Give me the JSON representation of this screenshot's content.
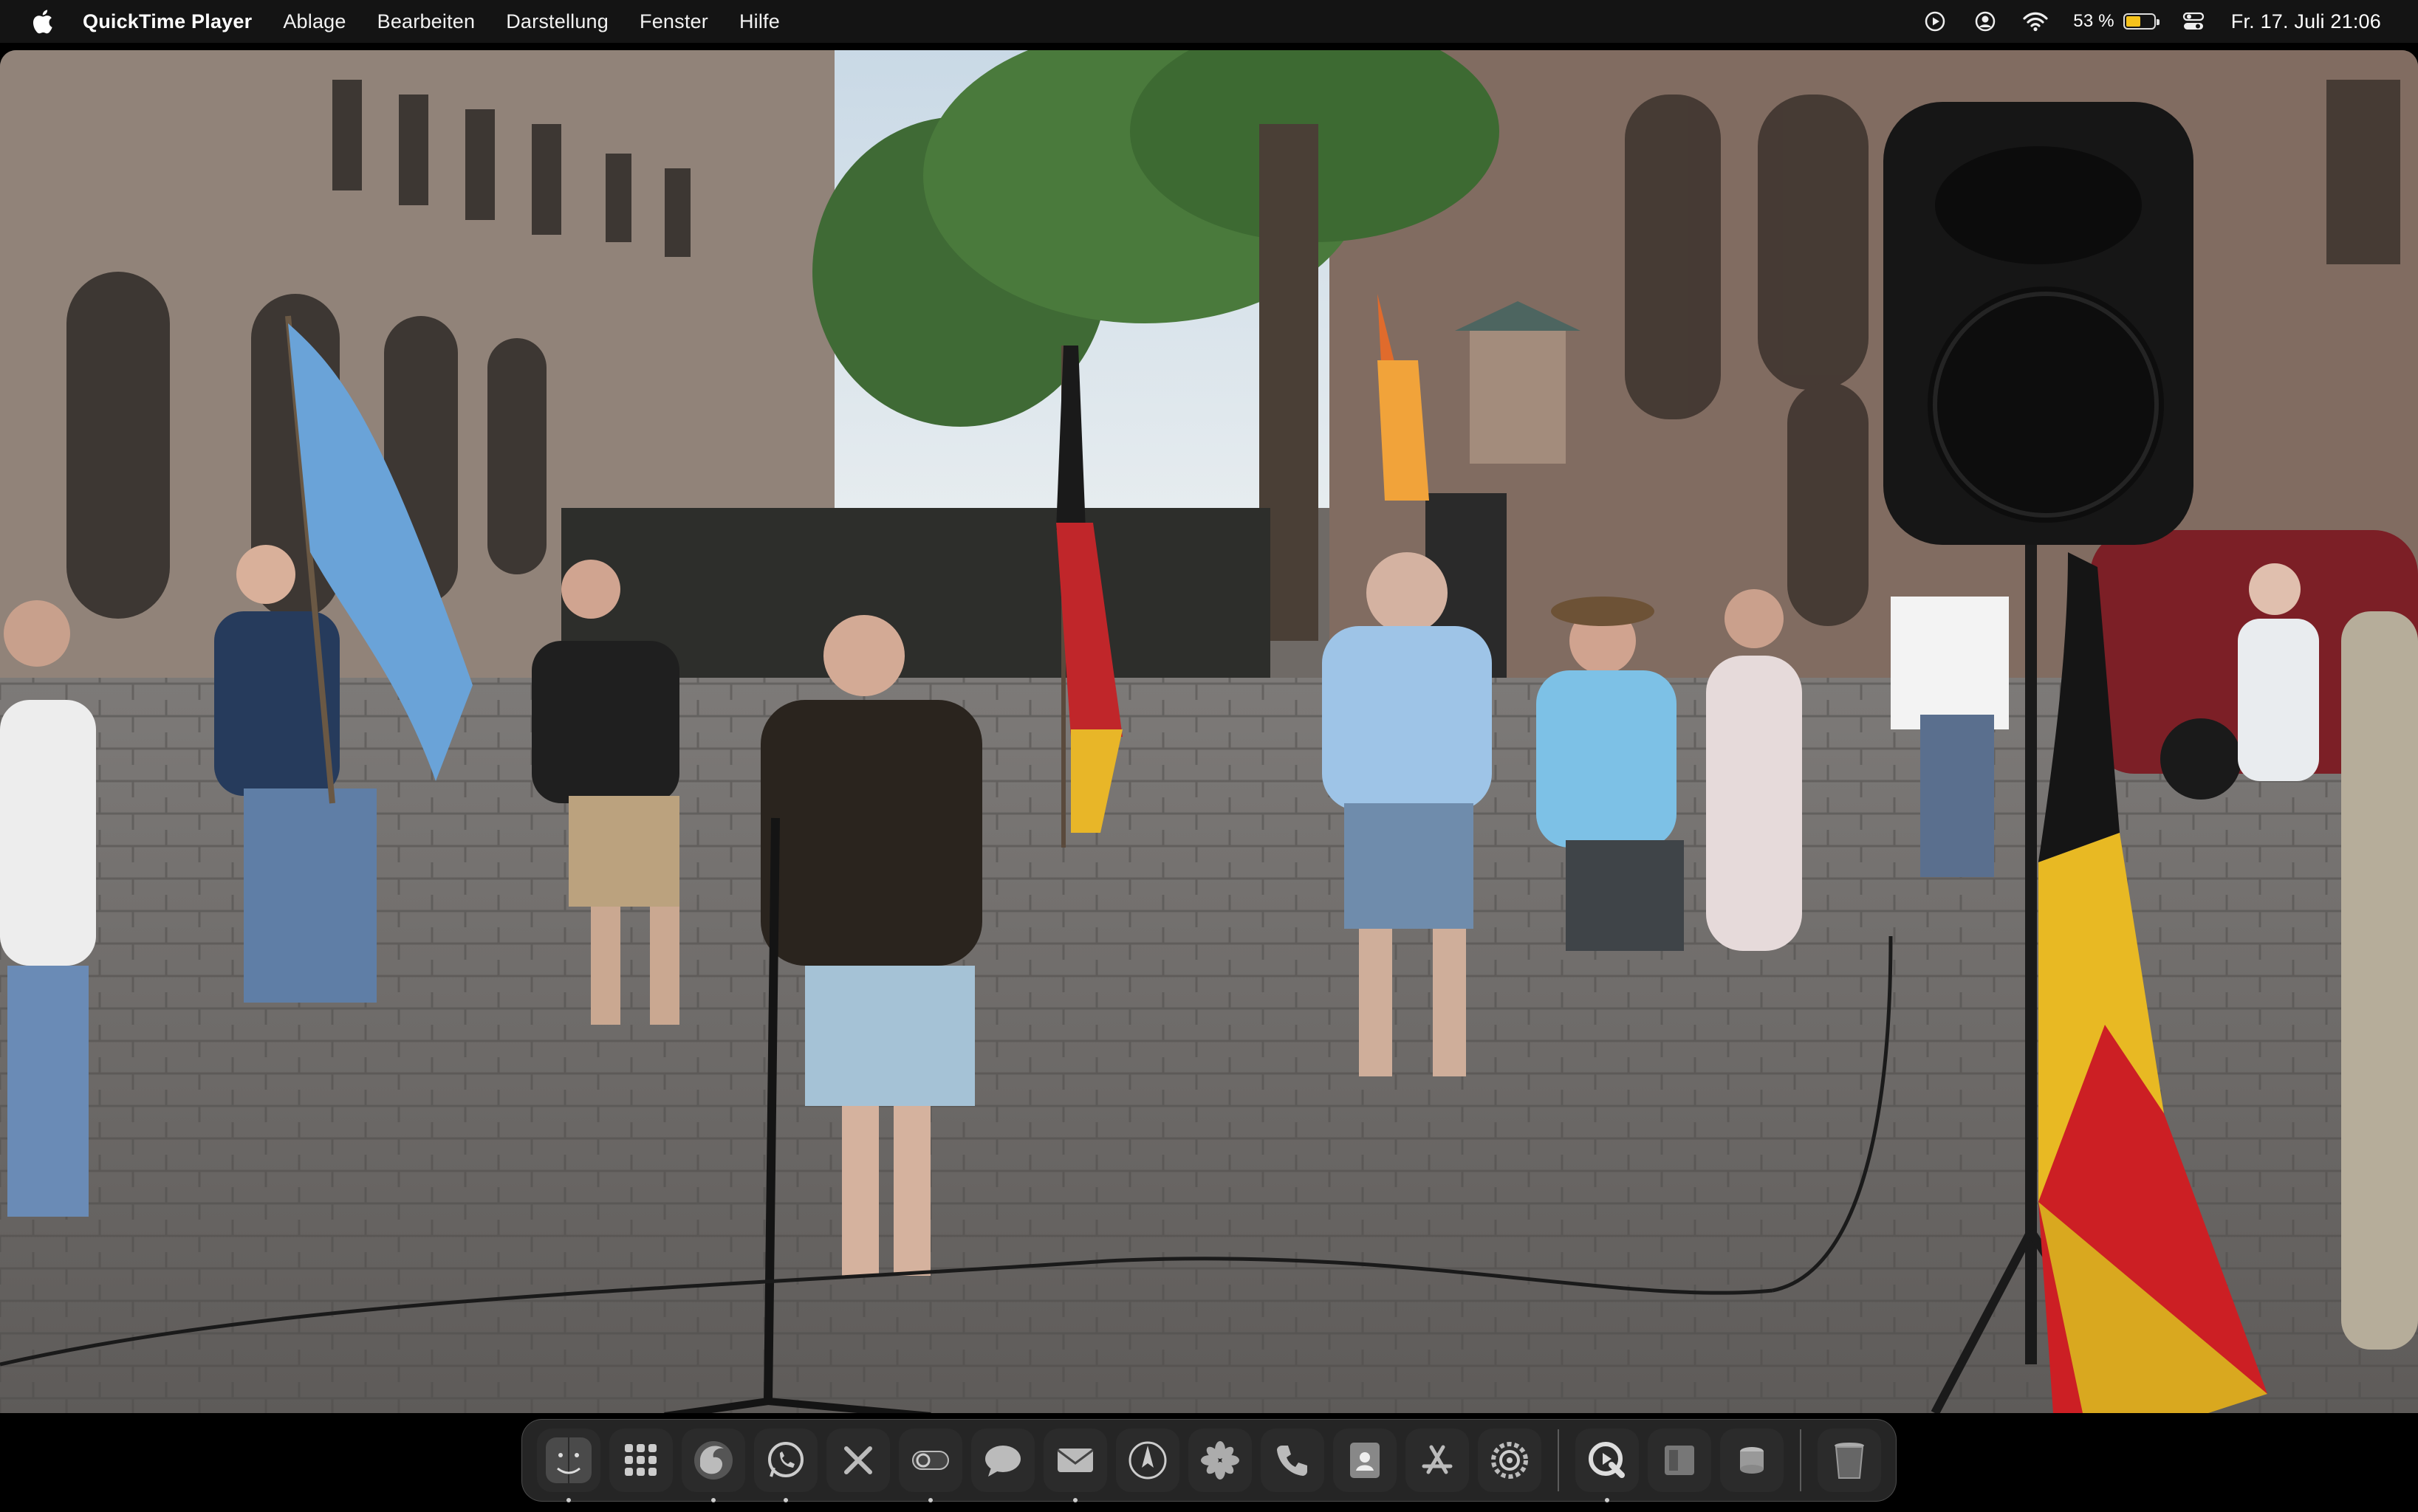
{
  "menubar": {
    "apple_icon": "apple-logo",
    "app_name": "QuickTime Player",
    "menus": [
      "Ablage",
      "Bearbeiten",
      "Darstellung",
      "Fenster",
      "Hilfe"
    ],
    "status": {
      "icons": [
        "play-circle-icon",
        "user-circle-icon",
        "wifi-icon"
      ],
      "battery_percent": "53 %",
      "battery_level": 0.53,
      "battery_color": "#f5c21b",
      "control_center_icon": "control-center-icon",
      "datetime": "Fr. 17. Juli  21:06"
    }
  },
  "video": {
    "content": "street-rally-scene"
  },
  "dock": {
    "apps": [
      {
        "name": "Finder",
        "icon": "finder-icon",
        "running": true
      },
      {
        "name": "Launchpad",
        "icon": "launchpad-icon",
        "running": false
      },
      {
        "name": "Firefox",
        "icon": "firefox-icon",
        "running": true
      },
      {
        "name": "WhatsApp",
        "icon": "whatsapp-icon",
        "running": true
      },
      {
        "name": "Tools",
        "icon": "tools-icon",
        "running": false
      },
      {
        "name": "Toggle",
        "icon": "toggle-icon",
        "running": true
      },
      {
        "name": "Messages",
        "icon": "messages-icon",
        "running": false
      },
      {
        "name": "Mail",
        "icon": "mail-icon",
        "running": true
      },
      {
        "name": "Compass",
        "icon": "compass-icon",
        "running": false
      },
      {
        "name": "Photos",
        "icon": "photos-icon",
        "running": false
      },
      {
        "name": "Phone",
        "icon": "phone-icon",
        "running": false
      },
      {
        "name": "Contacts",
        "icon": "contacts-icon",
        "running": false
      },
      {
        "name": "App Store",
        "icon": "app-store-icon",
        "running": false
      },
      {
        "name": "System Settings",
        "icon": "system-settings-icon",
        "running": false
      }
    ],
    "recent_apps": [
      {
        "name": "QuickTime Player",
        "icon": "quicktime-icon",
        "running": true
      },
      {
        "name": "Preview",
        "icon": "preview-icon",
        "running": false
      },
      {
        "name": "Disk Utility",
        "icon": "disk-icon",
        "running": false
      }
    ],
    "trash": {
      "name": "Trash",
      "icon": "trash-icon"
    }
  }
}
